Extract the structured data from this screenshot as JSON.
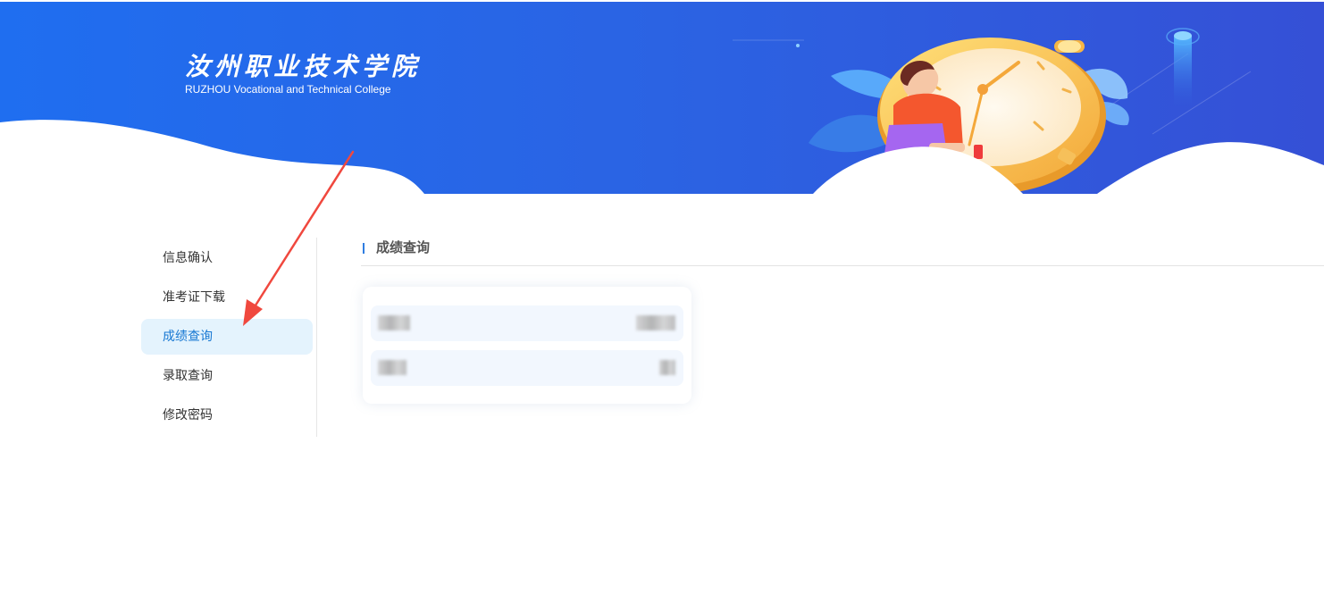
{
  "header": {
    "logo_cn": "汝州职业技术学院",
    "logo_en": "RUZHOU Vocational and Technical College"
  },
  "sidebar": {
    "items": [
      {
        "label": "信息确认",
        "active": false
      },
      {
        "label": "准考证下载",
        "active": false
      },
      {
        "label": "成绩查询",
        "active": true
      },
      {
        "label": "录取查询",
        "active": false
      },
      {
        "label": "修改密码",
        "active": false
      }
    ]
  },
  "main": {
    "section_title": "成绩查询",
    "score_rows": [
      {
        "label": "",
        "value": ""
      },
      {
        "label": "",
        "value": ""
      }
    ]
  },
  "colors": {
    "banner_blue": "#2a6be6",
    "active_bg": "#e4f3fd",
    "active_text": "#1677d2",
    "accent": "#2f7de1",
    "annotation_red": "#f0483e"
  }
}
